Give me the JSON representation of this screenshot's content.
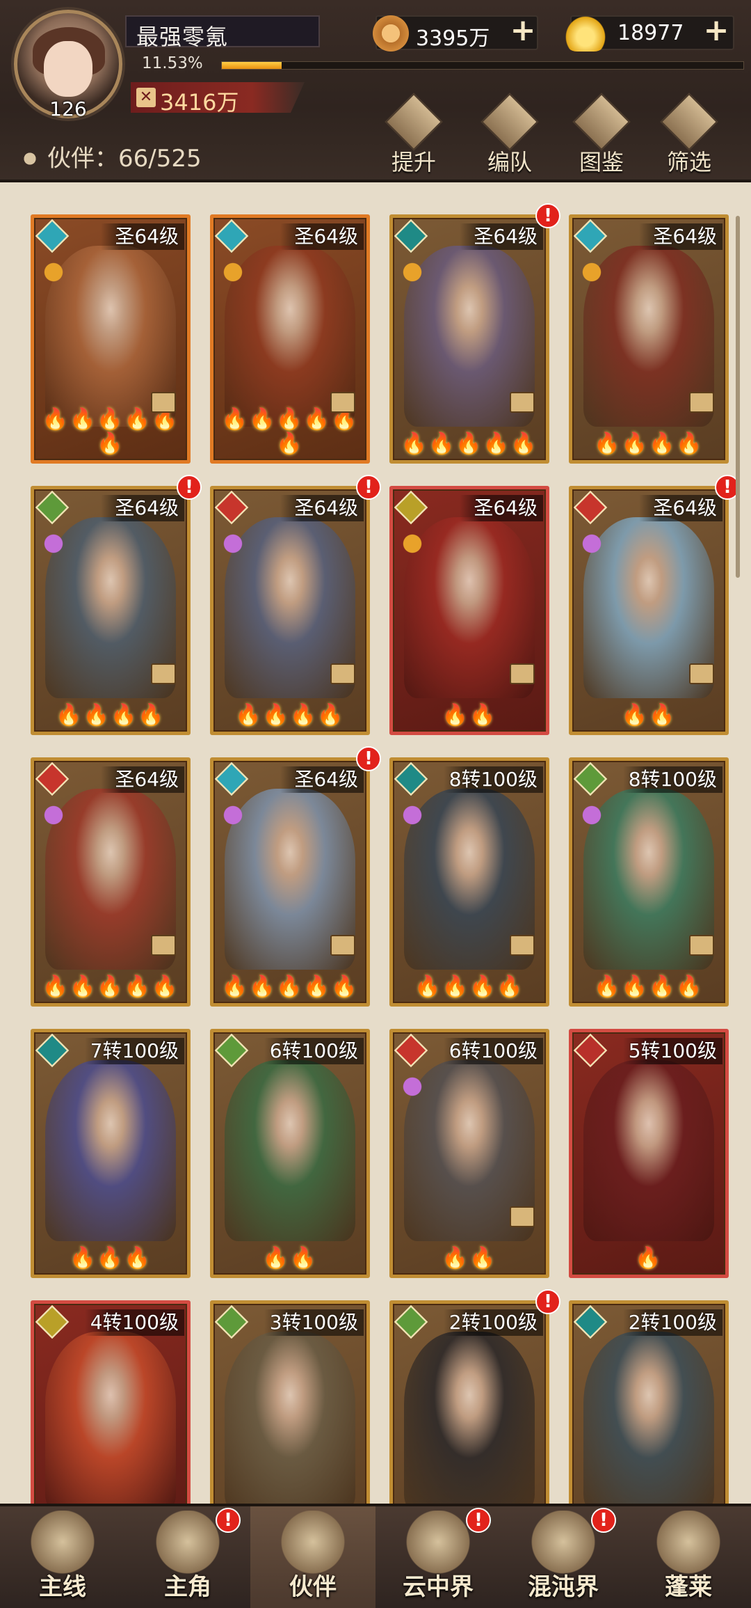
{
  "player": {
    "name": "最强零氪",
    "level": "126",
    "exp_text": "11.53%",
    "exp_percent": 11.53,
    "power": "3416万"
  },
  "currency": {
    "copper": "3395万",
    "gold": "18977"
  },
  "actions": [
    {
      "label": "提升",
      "icon": "upgrade-icon"
    },
    {
      "label": "编队",
      "icon": "formation-flag-icon"
    },
    {
      "label": "图鉴",
      "icon": "scroll-book-icon"
    },
    {
      "label": "筛选",
      "icon": "filter-icon"
    }
  ],
  "partners": {
    "label": "伙伴：66/525"
  },
  "colors": {
    "gold_frame": "#c08d33",
    "red_frame": "#d34b42",
    "badge": "#e2221b"
  },
  "cards": [
    {
      "level": "圣64级",
      "frame": "orange",
      "elem": "#2fa6b6",
      "sub": "#e8a22a",
      "flames": "🔥🔥🔥🔥🔥🔥",
      "badge": false,
      "bg": "#a9643a"
    },
    {
      "level": "圣64级",
      "frame": "orange",
      "elem": "#2fa6b6",
      "sub": "#e8a22a",
      "flames": "🔥🔥🔥🔥🔥🔥",
      "badge": false,
      "bg": "#8e3a20"
    },
    {
      "level": "圣64级",
      "frame": "gold",
      "elem": "#1f8a86",
      "sub": "#e8a22a",
      "flames": "🔥🔥🔥🔥🔥",
      "badge": true,
      "bg": "#6a5a78"
    },
    {
      "level": "圣64级",
      "frame": "gold",
      "elem": "#2fa6b6",
      "sub": "#e8a22a",
      "flames": "🔥🔥🔥🔥",
      "badge": false,
      "bg": "#7e2f22"
    },
    {
      "level": "圣64级",
      "frame": "gold",
      "elem": "#5e9a3a",
      "sub": "#c46ed8",
      "flames": "🔥🔥🔥🔥",
      "badge": true,
      "bg": "#4f5d6a"
    },
    {
      "level": "圣64级",
      "frame": "gold",
      "elem": "#c7352c",
      "sub": "#c46ed8",
      "flames": "🔥🔥🔥🔥",
      "badge": true,
      "bg": "#58607a"
    },
    {
      "level": "圣64级",
      "frame": "red",
      "elem": "#b9a028",
      "sub": "#e8a22a",
      "flames": "🔥🔥",
      "badge": false,
      "bg": "#9a2a22"
    },
    {
      "level": "圣64级",
      "frame": "gold",
      "elem": "#c7352c",
      "sub": "#c46ed8",
      "flames": "🔥🔥",
      "badge": true,
      "bg": "#7fa2b8"
    },
    {
      "level": "圣64级",
      "frame": "gold",
      "elem": "#c7352c",
      "sub": "#c46ed8",
      "flames": "🔥🔥🔥🔥🔥",
      "badge": false,
      "bg": "#9b3a2a"
    },
    {
      "level": "圣64级",
      "frame": "gold",
      "elem": "#2fa6b6",
      "sub": "#c46ed8",
      "flames": "🔥🔥🔥🔥🔥",
      "badge": true,
      "bg": "#7d8ea4"
    },
    {
      "level": "8转100级",
      "frame": "gold",
      "elem": "#1f8a86",
      "sub": "#c46ed8",
      "flames": "🔥🔥🔥🔥",
      "badge": false,
      "bg": "#3a4652"
    },
    {
      "level": "8转100级",
      "frame": "gold",
      "elem": "#5e9a3a",
      "sub": "#c46ed8",
      "flames": "🔥🔥🔥🔥",
      "badge": false,
      "bg": "#3f7a5e"
    },
    {
      "level": "7转100级",
      "frame": "gold",
      "elem": "#1f8a86",
      "sub": "",
      "flames": "🔥🔥🔥",
      "badge": false,
      "bg": "#4e4d8a"
    },
    {
      "level": "6转100级",
      "frame": "gold",
      "elem": "#5e9a3a",
      "sub": "",
      "flames": "🔥🔥",
      "badge": false,
      "bg": "#3d6a42"
    },
    {
      "level": "6转100级",
      "frame": "gold",
      "elem": "#c7352c",
      "sub": "#c46ed8",
      "flames": "🔥🔥",
      "badge": false,
      "bg": "#555050"
    },
    {
      "level": "5转100级",
      "frame": "red",
      "elem": "#b8302a",
      "sub": "",
      "flames": "🔥",
      "badge": false,
      "bg": "#6a1e1e"
    },
    {
      "level": "4转100级",
      "frame": "red",
      "elem": "#b9a028",
      "sub": "",
      "flames": "",
      "badge": false,
      "bg": "#c24a2a"
    },
    {
      "level": "3转100级",
      "frame": "gold",
      "elem": "#5e9a3a",
      "sub": "",
      "flames": "",
      "badge": false,
      "bg": "#6a5c44"
    },
    {
      "level": "2转100级",
      "frame": "gold",
      "elem": "#5e9a3a",
      "sub": "",
      "flames": "",
      "badge": true,
      "bg": "#2e2a2a"
    },
    {
      "level": "2转100级",
      "frame": "gold",
      "elem": "#1f8a86",
      "sub": "",
      "flames": "",
      "badge": false,
      "bg": "#3e4e56"
    }
  ],
  "nav": [
    {
      "label": "主线",
      "icon": "crossed-swords-icon",
      "badge": false,
      "active": false
    },
    {
      "label": "主角",
      "icon": "hero-helmet-icon",
      "badge": true,
      "active": false
    },
    {
      "label": "伙伴",
      "icon": "partner-crown-icon",
      "badge": false,
      "active": true
    },
    {
      "label": "云中界",
      "icon": "cloud-pavilion-icon",
      "badge": true,
      "active": false
    },
    {
      "label": "混沌界",
      "icon": "chaos-tower-icon",
      "badge": true,
      "active": false
    },
    {
      "label": "蓬莱",
      "icon": "penglai-sage-icon",
      "badge": false,
      "active": false
    }
  ]
}
